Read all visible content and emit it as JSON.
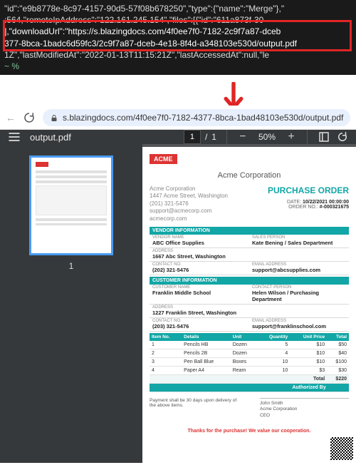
{
  "terminal": {
    "line1_a": "\"id\":\"e9b8778e-8c97-4157-90d5-57f08b678250\",\"type\":{\"name\":\"Merge\"},\"",
    "line2_a": ":564,\"remoteIpAddress\":\"122.161.245.154\",\"files\":[{\"id\":\"611a873f-30",
    "line3_a": "],\"downloadUrl\":\"https://s.blazingdocs.com/4f0ee7f0-7182-2c9f7a87-dceb",
    "line4_a": "377-8bca-1badc6d59fc3/2c9f7a87-dceb-4e18-8f4d-a348103e530d/output.pdf",
    "line5_a": "1Z\",\"lastModifiedAt\":\"2022-01-13T11:15:21Z\",\"lastAccessedAt\":null,\"le",
    "prompt": "~ % "
  },
  "browser": {
    "url_display": "s.blazingdocs.com/4f0ee7f0-7182-4377-8bca-1bad48103e530d/output.pdf"
  },
  "viewer": {
    "title": "output.pdf",
    "page_current": "1",
    "page_total": "1",
    "zoom": "50%",
    "thumb_label": "1"
  },
  "doc": {
    "brand": "ACME",
    "title": "Acme Corporation",
    "company": {
      "name": "Acme Corporation",
      "addr": "1447 Acme Street, Washington",
      "phone": "(201) 321-5476",
      "email": "support@acmecorp.com",
      "site": "acmecorp.com"
    },
    "po_label": "PURCHASE ORDER",
    "po_date_lbl": "DATE:",
    "po_date": "10/22/2021 00:00:00",
    "po_no_lbl": "ORDER NO.:",
    "po_no": "#-000321675",
    "vendor_head": "VENDOR INFORMATION",
    "vendor": {
      "name_lbl": "VENDOR NAME",
      "name": "ABC Office Supplies",
      "sales_lbl": "SALES PERSON",
      "sales": "Kate Bening / Sales Department",
      "addr_lbl": "ADDRESS",
      "addr": "1667 Abc Street, Washington",
      "contact_lbl": "CONTACT NO.",
      "contact": "(202) 321-5476",
      "email_lbl": "EMAIL ADDRESS",
      "email": "support@abcsupplies.com"
    },
    "cust_head": "CUSTOMER INFORMATION",
    "cust": {
      "name_lbl": "CUSTOMER NAME",
      "name": "Franklin Middle School",
      "person_lbl": "CONTACT PERSON",
      "person": "Helen Wilson / Purchasing Department",
      "addr_lbl": "ADDRESS",
      "addr": "1227 Franklin Street, Washington",
      "contact_lbl": "CONTACT NO.",
      "contact": "(203) 321-5476",
      "email_lbl": "EMAIL ADDRESS",
      "email": "support@franklinschool.com"
    },
    "cols": {
      "no": "Item No.",
      "det": "Details",
      "unit": "Unit",
      "qty": "Quantity",
      "price": "Unit Price",
      "tot": "Total"
    },
    "rows": [
      {
        "no": "1",
        "det": "Pencils HB",
        "unit": "Dozen",
        "qty": "5",
        "price": "$10",
        "tot": "$50"
      },
      {
        "no": "2",
        "det": "Pencils 2B",
        "unit": "Dozen",
        "qty": "4",
        "price": "$10",
        "tot": "$40"
      },
      {
        "no": "3",
        "det": "Pen Ball Blue",
        "unit": "Boxes",
        "qty": "10",
        "price": "$10",
        "tot": "$100"
      },
      {
        "no": "4",
        "det": "Paper A4",
        "unit": "Ream",
        "qty": "10",
        "price": "$3",
        "tot": "$30"
      }
    ],
    "total_lbl": "Total",
    "total": "$220",
    "auth_lbl": "Authorized By",
    "terms": "Payment shall be 30 days upon delivery of the above items.",
    "sig": {
      "name": "John Smith",
      "org": "Acme Corporation",
      "role": "CEO"
    },
    "thanks": "Thanks for the purchase! We value our cooperation."
  }
}
